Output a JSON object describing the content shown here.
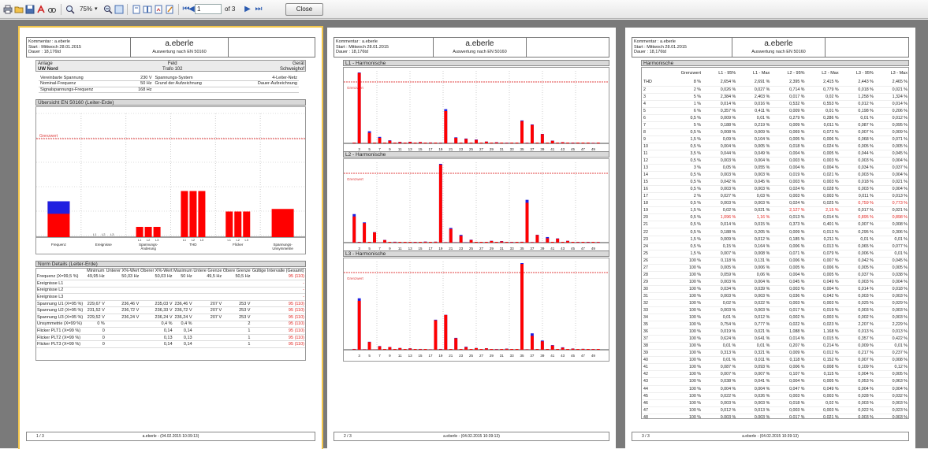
{
  "toolbar": {
    "zoom": "75%",
    "page_input": "1",
    "page_count": "of 3",
    "close_label": "Close"
  },
  "header": {
    "kommentar": "Kommentar : a.eberle",
    "start": "Start : Mittwoch 28.01.2015",
    "dauer": "Dauer : 18,176td",
    "company": "a.eberle",
    "subtitle": "Auswertung nach EN 50160"
  },
  "page1": {
    "anlage_label": "Anlage",
    "anlage_value": "UW Nord",
    "feld_label": "Feld",
    "feld_value": "Trafo 102",
    "geraet_label": "Gerät",
    "geraet_value": "Schweighof",
    "info_rows": [
      {
        "k": "Vereinbarte Spannung",
        "v": "230 V",
        "k2": "Spannungs-System",
        "v2": "4-Leiter-Netz"
      },
      {
        "k": "Nominal-Frequenz",
        "v": "50 Hz",
        "k2": "Grund der Aufzeichnung",
        "v2": "Dauer-Aufzeichnung"
      },
      {
        "k": "Signalspannungs-Frequenz",
        "v": "168 Hz",
        "k2": "",
        "v2": ""
      }
    ],
    "overview_title": "Übersicht EN 50160 (Leiter-Erde)",
    "grenzwert": "Grenzwert",
    "category_labels": [
      "Frequenz",
      "Ereignisse",
      "Spannungs-\nÄnderung",
      "THD",
      "Flicker",
      "Spannungs-\nUnsymmetrie"
    ],
    "sub_labels": [
      "L1",
      "L2",
      "L3"
    ],
    "norm_title": "Norm Details (Leiter-Erde)",
    "norm_headers": [
      "",
      "Minimum",
      "Unterer X%-Wert",
      "Oberer X%-Wert",
      "Maximum",
      "Untere Grenze",
      "Obere Grenze",
      "Gültige Intervalle (Gesamt)"
    ],
    "norm_rows": [
      [
        "Frequenz (X=99,5 %)",
        "49,95 Hz",
        "50,03 Hz",
        "50,03 Hz",
        "50 Hz",
        "49,5 Hz",
        "50,5 Hz",
        "95 (110)"
      ],
      [
        "Ereignisse L1",
        "",
        "",
        "",
        "",
        "",
        "",
        "-"
      ],
      [
        "Ereignisse L2",
        "",
        "",
        "",
        "",
        "",
        "",
        "-"
      ],
      [
        "Ereignisse L3",
        "",
        "",
        "",
        "",
        "",
        "",
        "-"
      ],
      [
        "Spannung U1 (X=95 %)",
        "229,67 V",
        "236,46 V",
        "235,03 V",
        "236,46 V",
        "207 V",
        "253 V",
        "95 (110)"
      ],
      [
        "Spannung U2 (X=95 %)",
        "231,52 V",
        "236,72 V",
        "236,33 V",
        "236,72 V",
        "207 V",
        "253 V",
        "95 (110)"
      ],
      [
        "Spannung U3 (X=95 %)",
        "229,52 V",
        "236,24 V",
        "236,24 V",
        "236,24 V",
        "207 V",
        "253 V",
        "95 (110)"
      ],
      [
        "Unsymmetrie (X=99 %)",
        "0 %",
        "",
        "0,4 %",
        "0,4 %",
        "",
        "2",
        "95 (110)"
      ],
      [
        "Flicker PLT1 (X=99 %)",
        "0",
        "",
        "0,14",
        "0,14",
        "",
        "1",
        "95 (110)"
      ],
      [
        "Flicker PLT2 (X=99 %)",
        "0",
        "",
        "0,13",
        "0,13",
        "",
        "1",
        "95 (110)"
      ],
      [
        "Flicker PLT3 (X=99 %)",
        "0",
        "",
        "0,14",
        "0,14",
        "",
        "1",
        "95 (110)"
      ]
    ],
    "footer_page": "1 / 3"
  },
  "page2": {
    "charts": [
      {
        "title": "L1 - Harmonische"
      },
      {
        "title": "L2 - Harmonische"
      },
      {
        "title": "L3 - Harmonische"
      }
    ],
    "grenzwert": "Grenzwert",
    "x_ticks": [
      "3",
      "5",
      "7",
      "9",
      "11",
      "13",
      "15",
      "17",
      "19",
      "21",
      "23",
      "25",
      "27",
      "29",
      "31",
      "33",
      "35",
      "37",
      "39",
      "41",
      "43",
      "45",
      "47",
      "49"
    ],
    "footer_page": "2 / 3"
  },
  "page3": {
    "section_title": "Harmonische",
    "headers": [
      "",
      "Grenzwert",
      "L1 - 95%",
      "L1 - Max",
      "L2 - 95%",
      "L2 - Max",
      "L3 - 95%",
      "L3 - Max"
    ],
    "rows": [
      [
        "THD",
        "8 %",
        "2,654 %",
        "2,691 %",
        "2,395 %",
        "2,415 %",
        "2,443 %",
        "2,465 %"
      ],
      [
        "2",
        "2 %",
        "0,026 %",
        "0,027 %",
        "0,714 %",
        "0,779 %",
        "0,018 %",
        "0,021 %"
      ],
      [
        "3",
        "5 %",
        "2,384 %",
        "2,403 %",
        "0,017 %",
        "0,02 %",
        "1,258 %",
        "1,324 %"
      ],
      [
        "4",
        "1 %",
        "0,014 %",
        "0,016 %",
        "0,532 %",
        "0,553 %",
        "0,012 %",
        "0,014 %"
      ],
      [
        "5",
        "6 %",
        "0,357 %",
        "0,411 %",
        "0,009 %",
        "0,01 %",
        "0,198 %",
        "0,206 %"
      ],
      [
        "6",
        "0,5 %",
        "0,009 %",
        "0,01 %",
        "0,279 %",
        "0,286 %",
        "0,01 %",
        "0,012 %"
      ],
      [
        "7",
        "5 %",
        "0,188 %",
        "0,219 %",
        "0,009 %",
        "0,011 %",
        "0,087 %",
        "0,095 %"
      ],
      [
        "8",
        "0,5 %",
        "0,008 %",
        "0,009 %",
        "0,069 %",
        "0,073 %",
        "0,007 %",
        "0,009 %"
      ],
      [
        "9",
        "1,5 %",
        "0,09 %",
        "0,104 %",
        "0,005 %",
        "0,006 %",
        "0,068 %",
        "0,071 %"
      ],
      [
        "10",
        "0,5 %",
        "0,004 %",
        "0,005 %",
        "0,018 %",
        "0,024 %",
        "0,005 %",
        "0,005 %"
      ],
      [
        "11",
        "3,5 %",
        "0,044 %",
        "0,049 %",
        "0,004 %",
        "0,005 %",
        "0,044 %",
        "0,045 %"
      ],
      [
        "12",
        "0,5 %",
        "0,003 %",
        "0,004 %",
        "0,003 %",
        "0,003 %",
        "0,003 %",
        "0,004 %"
      ],
      [
        "13",
        "3 %",
        "0,05 %",
        "0,055 %",
        "0,004 %",
        "0,004 %",
        "0,034 %",
        "0,037 %"
      ],
      [
        "14",
        "0,5 %",
        "0,003 %",
        "0,003 %",
        "0,019 %",
        "0,021 %",
        "0,003 %",
        "0,004 %"
      ],
      [
        "15",
        "0,5 %",
        "0,042 %",
        "0,045 %",
        "0,003 %",
        "0,003 %",
        "0,018 %",
        "0,021 %"
      ],
      [
        "16",
        "0,5 %",
        "0,003 %",
        "0,003 %",
        "0,024 %",
        "0,028 %",
        "0,003 %",
        "0,004 %"
      ],
      [
        "17",
        "2 %",
        "0,027 %",
        "0,03 %",
        "0,003 %",
        "0,003 %",
        "0,011 %",
        "0,013 %"
      ],
      [
        "18",
        "0,5 %",
        "0,003 %",
        "0,003 %",
        "0,024 %",
        "0,025 %",
        "0,759 %",
        "0,773 %"
      ],
      [
        "19",
        "1,5 %",
        "0,02 %",
        "0,021 %",
        "2,127 %",
        "2,15 %",
        "0,017 %",
        "0,021 %"
      ],
      [
        "20",
        "0,5 %",
        "1,096 %",
        "1,16 %",
        "0,013 %",
        "0,014 %",
        "0,895 %",
        "0,898 %"
      ],
      [
        "21",
        "0,5 %",
        "0,014 %",
        "0,015 %",
        "0,373 %",
        "0,401 %",
        "0,007 %",
        "0,008 %"
      ],
      [
        "22",
        "0,5 %",
        "0,188 %",
        "0,205 %",
        "0,009 %",
        "0,013 %",
        "0,295 %",
        "0,306 %"
      ],
      [
        "23",
        "1,5 %",
        "0,009 %",
        "0,012 %",
        "0,185 %",
        "0,211 %",
        "0,01 %",
        "0,01 %"
      ],
      [
        "24",
        "0,5 %",
        "0,15 %",
        "0,164 %",
        "0,006 %",
        "0,013 %",
        "0,065 %",
        "0,077 %"
      ],
      [
        "25",
        "1,5 %",
        "0,007 %",
        "0,008 %",
        "0,071 %",
        "0,079 %",
        "0,006 %",
        "0,01 %"
      ],
      [
        "26",
        "100 %",
        "0,118 %",
        "0,131 %",
        "0,006 %",
        "0,007 %",
        "0,042 %",
        "0,045 %"
      ],
      [
        "27",
        "100 %",
        "0,005 %",
        "0,006 %",
        "0,005 %",
        "0,006 %",
        "0,005 %",
        "0,005 %"
      ],
      [
        "28",
        "100 %",
        "0,059 %",
        "0,06 %",
        "0,004 %",
        "0,005 %",
        "0,037 %",
        "0,038 %"
      ],
      [
        "29",
        "100 %",
        "0,003 %",
        "0,004 %",
        "0,045 %",
        "0,049 %",
        "0,003 %",
        "0,004 %"
      ],
      [
        "30",
        "100 %",
        "0,034 %",
        "0,039 %",
        "0,003 %",
        "0,004 %",
        "0,014 %",
        "0,018 %"
      ],
      [
        "31",
        "100 %",
        "0,003 %",
        "0,003 %",
        "0,036 %",
        "0,042 %",
        "0,003 %",
        "0,003 %"
      ],
      [
        "32",
        "100 %",
        "0,02 %",
        "0,022 %",
        "0,003 %",
        "0,003 %",
        "0,025 %",
        "0,029 %"
      ],
      [
        "33",
        "100 %",
        "0,003 %",
        "0,003 %",
        "0,017 %",
        "0,019 %",
        "0,003 %",
        "0,003 %"
      ],
      [
        "34",
        "100 %",
        "0,01 %",
        "0,012 %",
        "0,002 %",
        "0,003 %",
        "0,002 %",
        "0,003 %"
      ],
      [
        "35",
        "100 %",
        "0,754 %",
        "0,777 %",
        "0,022 %",
        "0,023 %",
        "2,207 %",
        "2,229 %"
      ],
      [
        "36",
        "100 %",
        "0,019 %",
        "0,021 %",
        "1,088 %",
        "1,168 %",
        "0,013 %",
        "0,013 %"
      ],
      [
        "37",
        "100 %",
        "0,624 %",
        "0,641 %",
        "0,014 %",
        "0,015 %",
        "0,357 %",
        "0,422 %"
      ],
      [
        "38",
        "100 %",
        "0,01 %",
        "0,01 %",
        "0,207 %",
        "0,214 %",
        "0,009 %",
        "0,01 %"
      ],
      [
        "39",
        "100 %",
        "0,313 %",
        "0,321 %",
        "0,009 %",
        "0,012 %",
        "0,217 %",
        "0,237 %"
      ],
      [
        "40",
        "100 %",
        "0,01 %",
        "0,011 %",
        "0,118 %",
        "0,152 %",
        "0,007 %",
        "0,008 %"
      ],
      [
        "41",
        "100 %",
        "0,087 %",
        "0,093 %",
        "0,006 %",
        "0,008 %",
        "0,109 %",
        "0,12 %"
      ],
      [
        "42",
        "100 %",
        "0,007 %",
        "0,007 %",
        "0,107 %",
        "0,115 %",
        "0,004 %",
        "0,005 %"
      ],
      [
        "43",
        "100 %",
        "0,038 %",
        "0,041 %",
        "0,004 %",
        "0,005 %",
        "0,053 %",
        "0,063 %"
      ],
      [
        "44",
        "100 %",
        "0,004 %",
        "0,004 %",
        "0,047 %",
        "0,049 %",
        "0,004 %",
        "0,004 %"
      ],
      [
        "45",
        "100 %",
        "0,022 %",
        "0,026 %",
        "0,003 %",
        "0,003 %",
        "0,028 %",
        "0,032 %"
      ],
      [
        "46",
        "100 %",
        "0,003 %",
        "0,003 %",
        "0,018 %",
        "0,02 %",
        "0,003 %",
        "0,003 %"
      ],
      [
        "47",
        "100 %",
        "0,012 %",
        "0,013 %",
        "0,003 %",
        "0,003 %",
        "0,022 %",
        "0,023 %"
      ],
      [
        "48",
        "100 %",
        "0,003 %",
        "0,003 %",
        "0,017 %",
        "0,021 %",
        "0,003 %",
        "0,003 %"
      ],
      [
        "49",
        "100 %",
        "0,017 %",
        "0,019 %",
        "0,002 %",
        "0,003 %",
        "0,018 %",
        "0,017 %"
      ],
      [
        "50",
        "100 %",
        "0,003 %",
        "0,003 %",
        "0,017 %",
        "0,017 %",
        "0,003 %",
        "0,003 %"
      ]
    ],
    "red_cells": [
      [
        18,
        4
      ],
      [
        18,
        5
      ],
      [
        17,
        6
      ],
      [
        17,
        7
      ],
      [
        19,
        2
      ],
      [
        19,
        3
      ],
      [
        19,
        6
      ],
      [
        19,
        7
      ]
    ],
    "footer_page": "3 / 3"
  },
  "footer_text": "a.eberle -  (04.02.2015 10:39:13)",
  "colors": {
    "bar_red": "#ff0000",
    "bar_blue": "#2020e0",
    "limit": "#e04040"
  }
}
